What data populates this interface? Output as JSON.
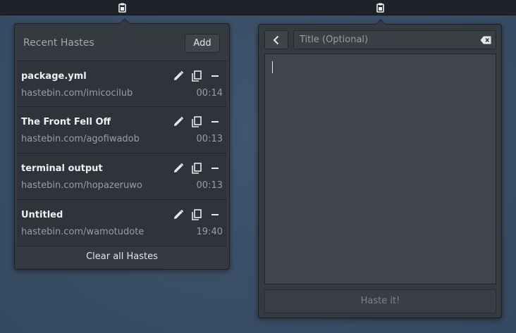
{
  "recent": {
    "header_title": "Recent Hastes",
    "add_label": "Add",
    "items": [
      {
        "title": "package.yml",
        "url": "hastebin.com/imicocilub",
        "time": "00:14"
      },
      {
        "title": "The Front Fell Off",
        "url": "hastebin.com/agofiwadob",
        "time": "00:13"
      },
      {
        "title": "terminal output",
        "url": "hastebin.com/hopazeruwo",
        "time": "00:13"
      },
      {
        "title": "Untitled",
        "url": "hastebin.com/wamotudote",
        "time": "19:40"
      }
    ],
    "clear_label": "Clear all Hastes"
  },
  "editor": {
    "title_placeholder": "Title (Optional)",
    "submit_label": "Haste it!"
  },
  "icons": {
    "tray": "clipboard-icon",
    "edit": "pencil-icon",
    "copy": "copy-icon",
    "remove": "minus-icon",
    "back": "chevron-left-icon",
    "clear_entry": "backspace-icon"
  },
  "colors": {
    "panel": "#353940",
    "topbar": "#1f2329",
    "desktop": "#3b5068"
  }
}
